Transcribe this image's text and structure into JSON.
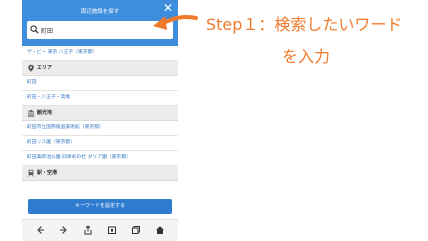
{
  "header": {
    "title": "周辺施設を探す",
    "close_glyph": "✕"
  },
  "search": {
    "value": "町田"
  },
  "rows": [
    {
      "type": "item",
      "label": "ザ・ビー 東京 八王子（東京都）"
    },
    {
      "type": "section",
      "label": "エリア",
      "icon": "pin-icon"
    },
    {
      "type": "item",
      "label": "町田"
    },
    {
      "type": "item",
      "label": "町田・八王子・高尾"
    },
    {
      "type": "section",
      "label": "観光地",
      "icon": "building-icon"
    },
    {
      "type": "item",
      "label": "町田市立国際版画美術館（東京都）"
    },
    {
      "type": "item",
      "label": "町田リス園（東京都）"
    },
    {
      "type": "item",
      "label": "町田薬師池公園 四季彩の杜 ダリア園（東京都）"
    },
    {
      "type": "section",
      "label": "駅・空港",
      "icon": "train-icon"
    }
  ],
  "footer": {
    "button_label": "キーワードを設定する"
  },
  "navbar": {
    "icons": [
      "back-icon",
      "forward-icon",
      "share-icon",
      "bookmarks-icon",
      "tabs-icon",
      "home-icon"
    ]
  },
  "annotation": {
    "line1": "Step１：検索したいワード",
    "line2": "を入力",
    "color": "#f07a2c"
  },
  "colors": {
    "header": "#3e8ede",
    "button": "#2e7bd0",
    "link": "#3a7cc4"
  }
}
